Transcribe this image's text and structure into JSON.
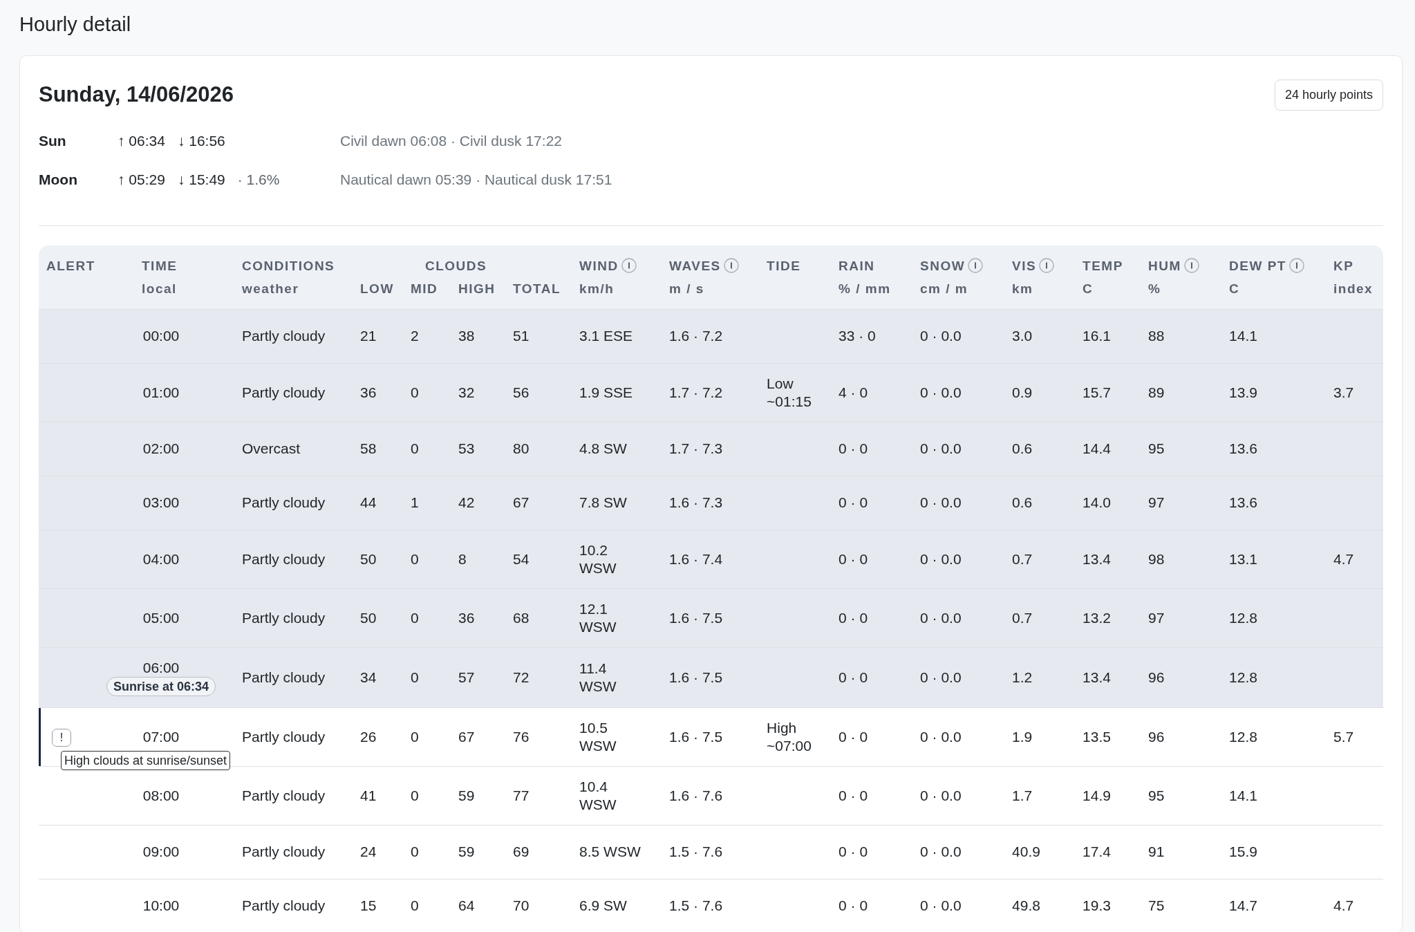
{
  "page_title": "Hourly detail",
  "day": {
    "date": "Sunday, 14/06/2026",
    "points_badge": "24 hourly points",
    "astro": [
      {
        "label": "Sun",
        "rise": "↑ 06:34",
        "set": "↓ 16:56",
        "twilight": "Civil dawn 06:08 · Civil dusk 17:22"
      },
      {
        "label": "Moon",
        "rise": "↑ 05:29",
        "set": "↓ 15:49",
        "illumination": "· 1.6%",
        "twilight": "Nautical dawn 05:39 · Nautical dusk 17:51"
      }
    ]
  },
  "table": {
    "columns": [
      {
        "label": "ALERT",
        "info": false
      },
      {
        "label": "TIME",
        "unit": "local",
        "info": false
      },
      {
        "label": "CONDITIONS",
        "unit": "weather",
        "info": false
      },
      {
        "group": "CLOUDS",
        "subcolumns": [
          "LOW",
          "MID",
          "HIGH",
          "TOTAL"
        ]
      },
      {
        "label": "WIND",
        "unit": "km/h",
        "info": true
      },
      {
        "label": "WAVES",
        "unit": "m / s",
        "info": true
      },
      {
        "label": "TIDE",
        "info": false
      },
      {
        "label": "RAIN",
        "unit": "% / mm",
        "info": false
      },
      {
        "label": "SNOW",
        "unit": "cm / m",
        "info": true
      },
      {
        "label": "VIS",
        "unit": "km",
        "info": true
      },
      {
        "label": "TEMP",
        "unit": "C",
        "info": false
      },
      {
        "label": "HUM",
        "unit": "%",
        "info": true
      },
      {
        "label": "DEW PT",
        "unit": "C",
        "info": true
      },
      {
        "label": "KP",
        "unit": "index",
        "info": false
      }
    ],
    "rows": [
      {
        "time": "00:00",
        "conditions": "Partly cloudy",
        "clouds": [
          "21",
          "2",
          "38",
          "51"
        ],
        "wind": "3.1 ESE",
        "waves": "1.6 · 7.2",
        "rain": "33 · 0",
        "snow": "0 · 0.0",
        "vis": "3.0",
        "temp": "16.1",
        "hum": "88",
        "dew": "14.1",
        "daylight": false,
        "current": false
      },
      {
        "time": "01:00",
        "conditions": "Partly cloudy",
        "clouds": [
          "36",
          "0",
          "32",
          "56"
        ],
        "wind": "1.9 SSE",
        "waves": "1.7 · 7.2",
        "tide": "Low ~01:15",
        "rain": "4 · 0",
        "snow": "0 · 0.0",
        "vis": "0.9",
        "temp": "15.7",
        "hum": "89",
        "dew": "13.9",
        "kp": "3.7",
        "daylight": false,
        "current": false
      },
      {
        "time": "02:00",
        "conditions": "Overcast",
        "clouds": [
          "58",
          "0",
          "53",
          "80"
        ],
        "wind": "4.8 SW",
        "waves": "1.7 · 7.3",
        "rain": "0 · 0",
        "snow": "0 · 0.0",
        "vis": "0.6",
        "temp": "14.4",
        "hum": "95",
        "dew": "13.6",
        "daylight": false,
        "current": false
      },
      {
        "time": "03:00",
        "conditions": "Partly cloudy",
        "clouds": [
          "44",
          "1",
          "42",
          "67"
        ],
        "wind": "7.8 SW",
        "waves": "1.6 · 7.3",
        "rain": "0 · 0",
        "snow": "0 · 0.0",
        "vis": "0.6",
        "temp": "14.0",
        "hum": "97",
        "dew": "13.6",
        "daylight": false,
        "current": false
      },
      {
        "time": "04:00",
        "conditions": "Partly cloudy",
        "clouds": [
          "50",
          "0",
          "8",
          "54"
        ],
        "wind": "10.2 WSW",
        "waves": "1.6 · 7.4",
        "rain": "0 · 0",
        "snow": "0 · 0.0",
        "vis": "0.7",
        "temp": "13.4",
        "hum": "98",
        "dew": "13.1",
        "kp": "4.7",
        "daylight": false,
        "current": false
      },
      {
        "time": "05:00",
        "conditions": "Partly cloudy",
        "clouds": [
          "50",
          "0",
          "36",
          "68"
        ],
        "wind": "12.1 WSW",
        "waves": "1.6 · 7.5",
        "rain": "0 · 0",
        "snow": "0 · 0.0",
        "vis": "0.7",
        "temp": "13.2",
        "hum": "97",
        "dew": "12.8",
        "daylight": false,
        "current": false
      },
      {
        "time": "06:00",
        "badge": "Sunrise at 06:34",
        "conditions": "Partly cloudy",
        "clouds": [
          "34",
          "0",
          "57",
          "72"
        ],
        "wind": "11.4 WSW",
        "waves": "1.6 · 7.5",
        "rain": "0 · 0",
        "snow": "0 · 0.0",
        "vis": "1.2",
        "temp": "13.4",
        "hum": "96",
        "dew": "12.8",
        "daylight": false,
        "current": false
      },
      {
        "time": "07:00",
        "alert": {
          "icon": "!",
          "tooltip": "High clouds at sunrise/sunset"
        },
        "conditions": "Partly cloudy",
        "clouds": [
          "26",
          "0",
          "67",
          "76"
        ],
        "wind": "10.5 WSW",
        "waves": "1.6 · 7.5",
        "tide": "High ~07:00",
        "rain": "0 · 0",
        "snow": "0 · 0.0",
        "vis": "1.9",
        "temp": "13.5",
        "hum": "96",
        "dew": "12.8",
        "kp": "5.7",
        "daylight": true,
        "current": true
      },
      {
        "time": "08:00",
        "conditions": "Partly cloudy",
        "clouds": [
          "41",
          "0",
          "59",
          "77"
        ],
        "wind": "10.4 WSW",
        "waves": "1.6 · 7.6",
        "rain": "0 · 0",
        "snow": "0 · 0.0",
        "vis": "1.7",
        "temp": "14.9",
        "hum": "95",
        "dew": "14.1",
        "daylight": true,
        "current": false
      },
      {
        "time": "09:00",
        "conditions": "Partly cloudy",
        "clouds": [
          "24",
          "0",
          "59",
          "69"
        ],
        "wind": "8.5 WSW",
        "waves": "1.5 · 7.6",
        "rain": "0 · 0",
        "snow": "0 · 0.0",
        "vis": "40.9",
        "temp": "17.4",
        "hum": "91",
        "dew": "15.9",
        "daylight": true,
        "current": false
      },
      {
        "time": "10:00",
        "conditions": "Partly cloudy",
        "clouds": [
          "15",
          "0",
          "64",
          "70"
        ],
        "wind": "6.9 SW",
        "waves": "1.5 · 7.6",
        "rain": "0 · 0",
        "snow": "0 · 0.0",
        "vis": "49.8",
        "temp": "19.3",
        "hum": "75",
        "dew": "14.7",
        "kp": "4.7",
        "daylight": true,
        "current": false
      }
    ]
  }
}
